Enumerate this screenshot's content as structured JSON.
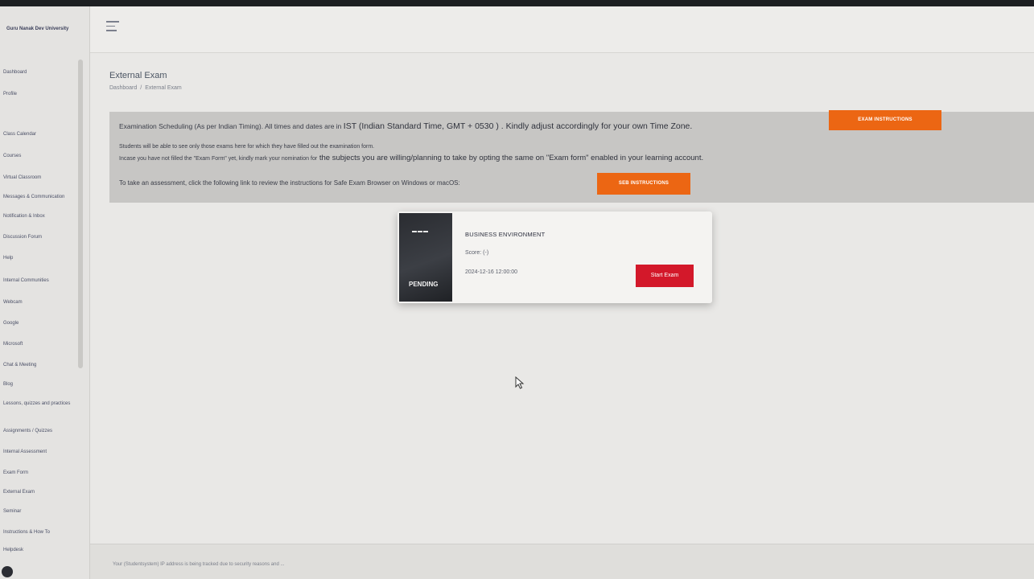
{
  "sidebar": {
    "brand": "Guru Nanak Dev University",
    "items": [
      "Dashboard",
      "Profile",
      "Class Calendar",
      "Courses",
      "Virtual Classroom",
      "Messages & Communication",
      "Notification & Inbox",
      "Discussion Forum",
      "Help",
      "Internal Communities",
      "Webcam",
      "Google",
      "Microsoft",
      "Chat & Meeting",
      "Blog",
      "Lessons, quizzes and practices",
      "Assignments / Quizzes",
      "Internal Assessment",
      "Exam Form",
      "External Exam",
      "Seminar",
      "Instructions & How To",
      "Helpdesk"
    ]
  },
  "page": {
    "title": "External Exam",
    "breadcrumb": {
      "home": "Dashboard",
      "separator": "/",
      "current": "External Exam"
    }
  },
  "info": {
    "line1_small": "Examination Scheduling (As per Indian Timing). All times and dates are in",
    "line1_big": "IST (Indian Standard Time, GMT + 0530 ) . Kindly adjust accordingly for your own Time Zone.",
    "exam_instructions_button": "EXAM INSTRUCTIONS",
    "line2": "Students will be able to see only those exams here for which they have filled out the examination form.",
    "line3_small": "Incase you have not filled the \"Exam Form\" yet, kindly mark your nomination for",
    "line3_big": "the subjects you are willing/planning to take by opting the same on \"Exam form\" enabled in your learning account.",
    "line4": "To take an assessment, click the following link to review the instructions for Safe Exam Browser on Windows or macOS:",
    "seb_button": "SEB INSTRUCTIONS"
  },
  "exam": {
    "status": "PENDING",
    "course": "BUSINESS ENVIRONMENT",
    "score": "Score: (-)",
    "datetime": "2024-12-16 12:00:00",
    "start_button": "Start Exam"
  },
  "footer": {
    "notice": "Your (Studentsystem) IP address is being tracked due to security reasons and ..."
  },
  "colors": {
    "accent_orange": "#ec6613",
    "start_red": "#d3182a",
    "panel_gray": "#c7c6c4"
  }
}
